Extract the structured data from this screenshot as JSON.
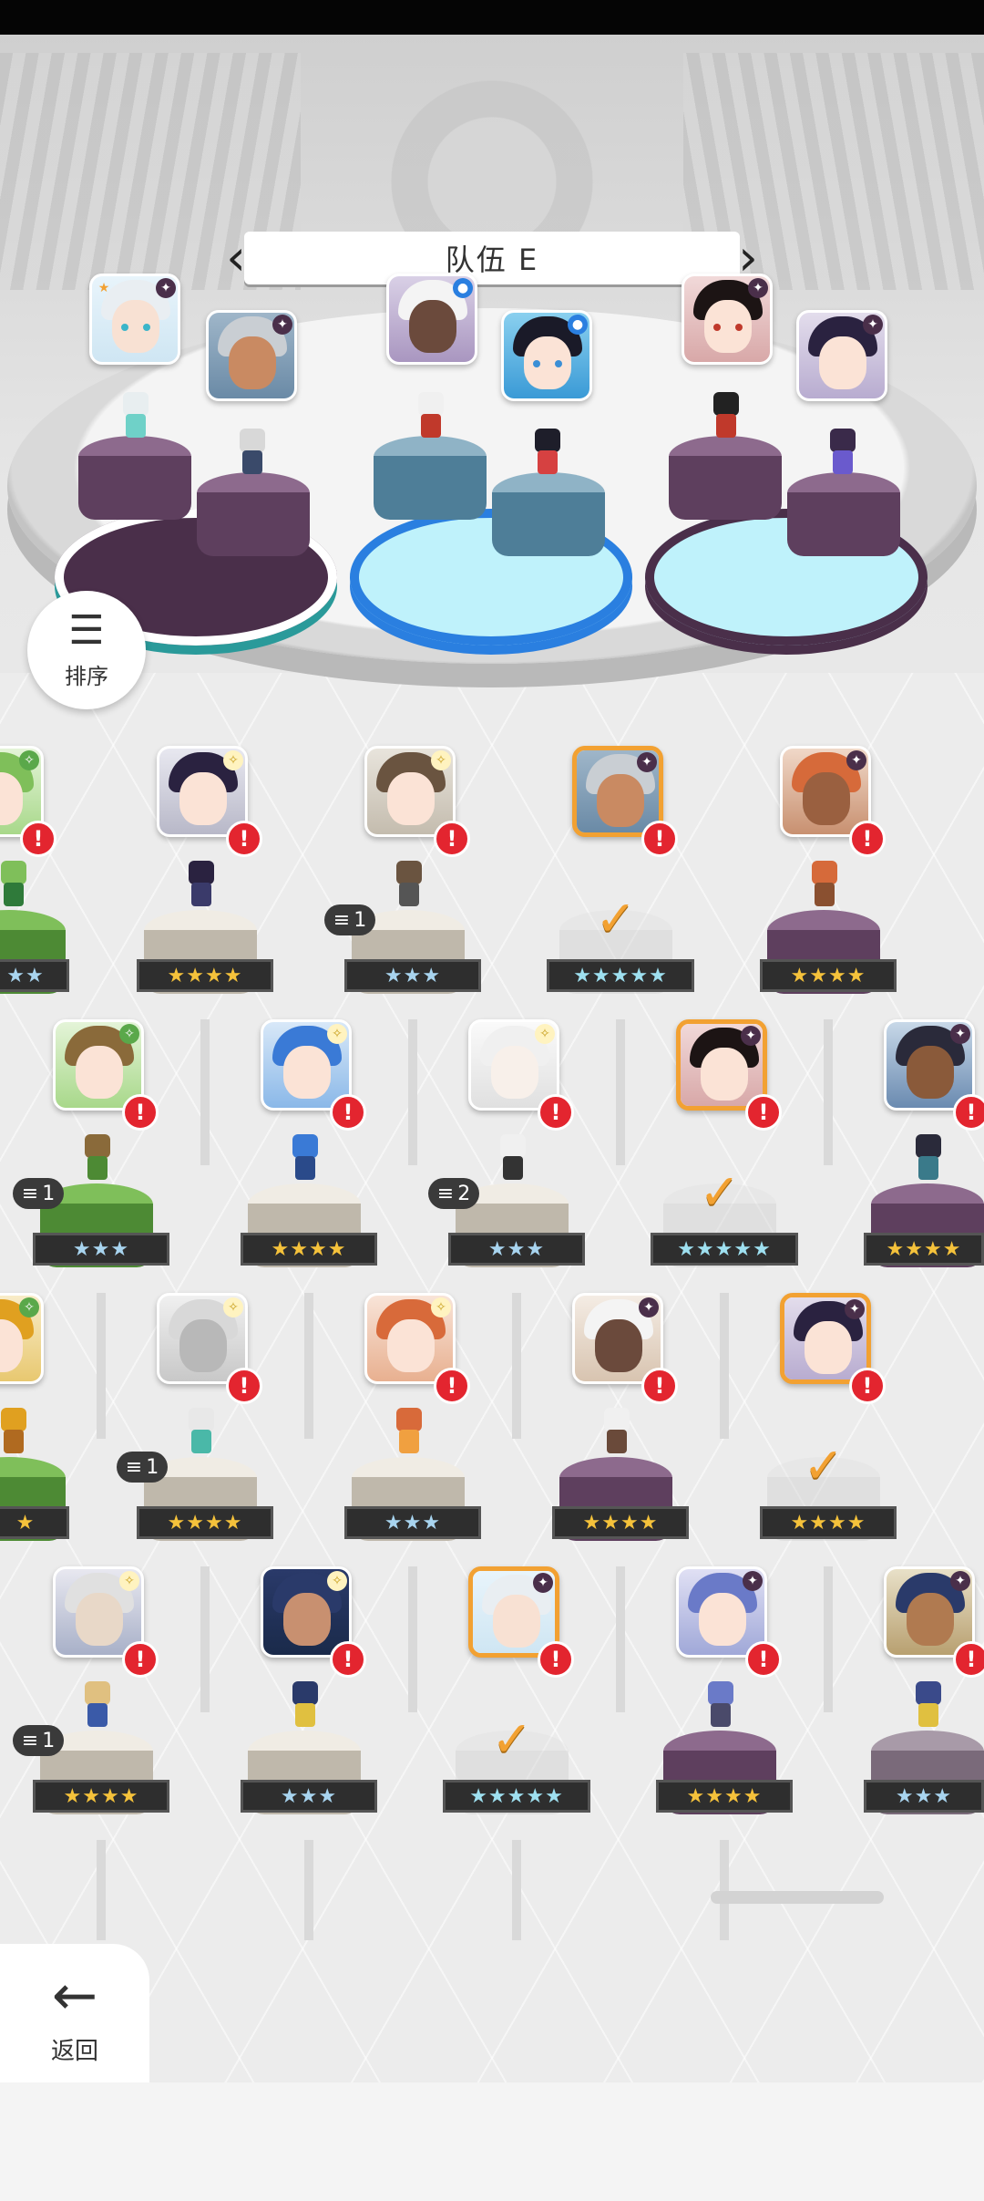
{
  "team": {
    "title": "队伍 E",
    "prev_icon": "chevron-left-icon",
    "next_icon": "chevron-right-icon"
  },
  "sort": {
    "label": "排序",
    "icon": "sort-descending-icon"
  },
  "back": {
    "label": "返回",
    "icon": "arrow-left-icon"
  },
  "roster_counts": {
    "row1_col3": "1",
    "row2_col1": "1",
    "row2_col3": "2",
    "row3_col2": "1",
    "row4_col1": "1"
  },
  "stars": {
    "r1c1": "★★",
    "r1c2": "★★★★",
    "r1c3": "★★★",
    "r1c4": "★★★★★",
    "r1c5": "★★★★",
    "r2c1": "★★★",
    "r2c2": "★★★★",
    "r2c3": "★★★",
    "r2c4": "★★★★★",
    "r2c5": "★★★★",
    "r3c1": "★",
    "r3c2": "★★★★",
    "r3c3": "★★★",
    "r3c4": "★★★★",
    "r3c5": "★★★★",
    "r4c1": "★★★★",
    "r4c2": "★★★",
    "r4c3": "★★★★★",
    "r4c4": "★★★★",
    "r4c5": "★★★"
  },
  "alert_mark": "!",
  "check_mark": "✓",
  "colors": {
    "accent_orange": "#f2a132",
    "alert_red": "#e3252f",
    "star_gold": "#f5c23b",
    "star_silver": "#a8d4ef"
  }
}
